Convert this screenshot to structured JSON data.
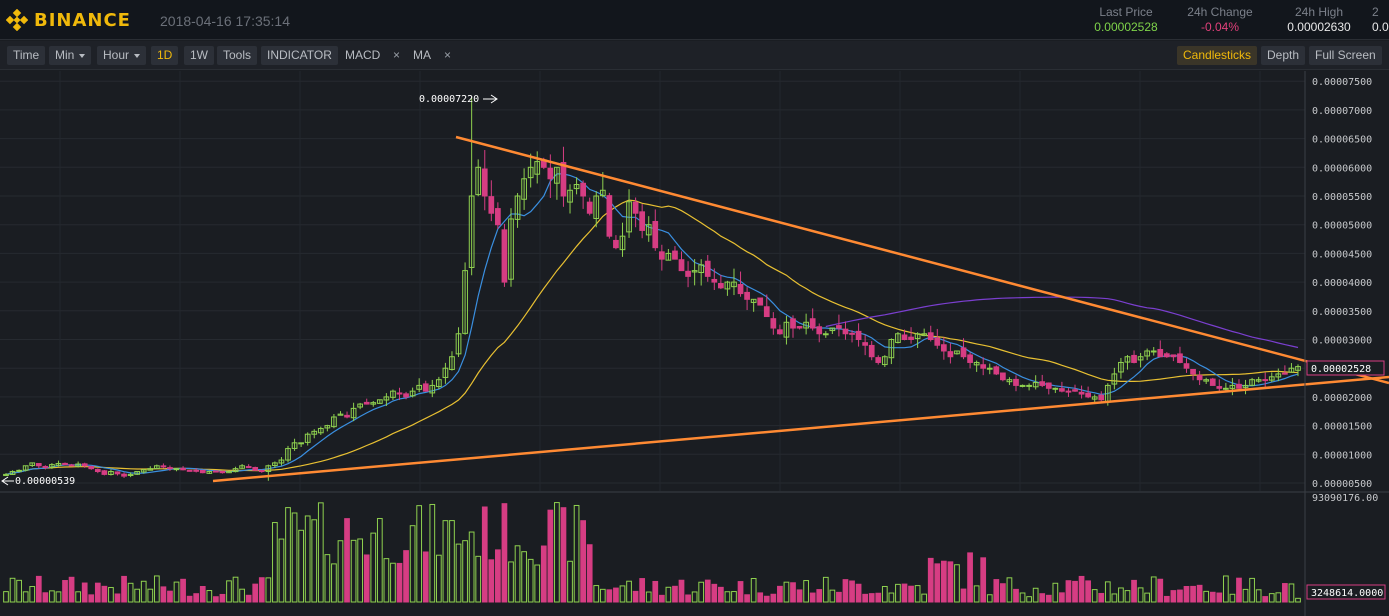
{
  "app": {
    "brand": "BINANCE",
    "timestamp": "2018-04-16 17:35:14"
  },
  "stats": {
    "last_price": {
      "label": "Last Price",
      "value": "0.00002528"
    },
    "change_24h": {
      "label": "24h Change",
      "value": "-0.04%"
    },
    "high_24h": {
      "label": "24h High",
      "value": "0.00002630"
    },
    "extra": {
      "label": "2",
      "value": "0.0"
    }
  },
  "toolbar": {
    "time": "Time",
    "min": "Min",
    "hour": "Hour",
    "d1": "1D",
    "w1": "1W",
    "tools": "Tools",
    "indicator": "INDICATOR",
    "macd": "MACD",
    "ma": "MA",
    "close_glyph": "×",
    "candlesticks": "Candlesticks",
    "depth": "Depth",
    "fullscreen": "Full Screen"
  },
  "price_axis": {
    "ticks": [
      "0.00007500",
      "0.00007000",
      "0.00006500",
      "0.00006000",
      "0.00005500",
      "0.00005000",
      "0.00004500",
      "0.00004000",
      "0.00003500",
      "0.00003000",
      "0.00002500",
      "0.00002000",
      "0.00001500",
      "0.00001000",
      "0.00000500"
    ],
    "current_label": "0.00002528"
  },
  "annotations": {
    "max_label": "0.00007220",
    "min_label": "0.00000539"
  },
  "volume_axis": {
    "top_label": "93090176.00",
    "current_label": "3248614.0000"
  },
  "colors": {
    "up": "#8fd14f",
    "down": "#d63d83",
    "ma_fast": "#3a8fe0",
    "ma_slow": "#e8c032",
    "ma_long": "#7b3fd0",
    "trendline": "#ff8a33",
    "accent": "#f0b90b"
  },
  "chart_data": {
    "type": "candlestick",
    "price_range": [
      4e-06,
      7.7e-05
    ],
    "price_ticks": [
      7.5e-05,
      7e-05,
      6.5e-05,
      6e-05,
      5.5e-05,
      5e-05,
      4.5e-05,
      4e-05,
      3.5e-05,
      3e-05,
      2.5e-05,
      2e-05,
      1.5e-05,
      1e-05,
      5e-06
    ],
    "max_price": 7.22e-05,
    "min_price": 5.39e-06,
    "last_price": 2.528e-05,
    "volume_max": 93090176,
    "volume_last": 3248614,
    "closes": [
      6.5e-06,
      7e-06,
      7.2e-06,
      8e-06,
      8.5e-06,
      8e-06,
      7.8e-06,
      8.2e-06,
      8.4e-06,
      8.2e-06,
      8e-06,
      8.3e-06,
      8e-06,
      7.5e-06,
      7e-06,
      6.5e-06,
      7e-06,
      6.6e-06,
      6.2e-06,
      6.5e-06,
      7e-06,
      7.3e-06,
      7.5e-06,
      8e-06,
      7.8e-06,
      7.5e-06,
      7.5e-06,
      7.3e-06,
      7.2e-06,
      7.2e-06,
      6.8e-06,
      7e-06,
      7e-06,
      6.8e-06,
      7e-06,
      7.5e-06,
      8e-06,
      7.8e-06,
      7.2e-06,
      7e-06,
      8e-06,
      8.5e-06,
      9e-06,
      1.1e-05,
      1.2e-05,
      1.2e-05,
      1.35e-05,
      1.4e-05,
      1.45e-05,
      1.5e-05,
      1.65e-05,
      1.7e-05,
      1.65e-05,
      1.8e-05,
      1.875e-05,
      1.875e-05,
      1.9e-05,
      1.95e-05,
      2e-05,
      2.1e-05,
      2.05e-05,
      2e-05,
      2.1e-05,
      2.2e-05,
      2.1e-05,
      2.2e-05,
      2.3e-05,
      2.5e-05,
      2.7e-05,
      3.1e-05,
      4.2e-05,
      5.5e-05,
      6e-05,
      5.5e-05,
      5.2e-05,
      5e-05,
      4e-05,
      5.1e-05,
      5.5e-05,
      5.8e-05,
      6e-05,
      6.1e-05,
      6e-05,
      5.8e-05,
      6e-05,
      5.5e-05,
      5.6e-05,
      5.7e-05,
      5.5e-05,
      5.2e-05,
      5.5e-05,
      5.6e-05,
      4.8e-05,
      4.6e-05,
      4.8e-05,
      5.4e-05,
      5.2e-05,
      4.9e-05,
      5e-05,
      4.6e-05,
      4.4e-05,
      4.5e-05,
      4.4e-05,
      4.2e-05,
      4.1e-05,
      4.2e-05,
      4.3e-05,
      4.1e-05,
      4e-05,
      3.9e-05,
      4e-05,
      4e-05,
      3.8e-05,
      3.7e-05,
      3.7e-05,
      3.6e-05,
      3.4e-05,
      3.2e-05,
      3.1e-05,
      3.3e-05,
      3.2e-05,
      3.2e-05,
      3.3e-05,
      3.2e-05,
      3.1e-05,
      3.1e-05,
      3.2e-05,
      3.2e-05,
      3.1e-05,
      3.1e-05,
      3e-05,
      2.9e-05,
      2.7e-05,
      2.6e-05,
      2.7e-05,
      3e-05,
      3.1e-05,
      3e-05,
      3e-05,
      3.1e-05,
      3.1e-05,
      3e-05,
      2.9e-05,
      2.8e-05,
      2.7e-05,
      2.8e-05,
      2.7e-05,
      2.6e-05,
      2.6e-05,
      2.5e-05,
      2.5e-05,
      2.4e-05,
      2.3e-05,
      2.3e-05,
      2.2e-05,
      2.2e-05,
      2.2e-05,
      2.25e-05,
      2.2e-05,
      2.15e-05,
      2.15e-05,
      2.1e-05,
      2.1e-05,
      2.1e-05,
      2.05e-05,
      2e-05,
      2e-05,
      1.95e-05,
      2.2e-05,
      2.4e-05,
      2.6e-05,
      2.7e-05,
      2.6e-05,
      2.7e-05,
      2.8e-05,
      2.8e-05,
      2.7e-05,
      2.7e-05,
      2.7e-05,
      2.6e-05,
      2.5e-05,
      2.4e-05,
      2.3e-05,
      2.3e-05,
      2.2e-05,
      2.15e-05,
      2.15e-05,
      2.2e-05,
      2.15e-05,
      2.2e-05,
      2.3e-05,
      2.3e-05,
      2.3e-05,
      2.35e-05,
      2.4e-05,
      2.4e-05,
      2.5e-05,
      2.528e-05
    ]
  }
}
